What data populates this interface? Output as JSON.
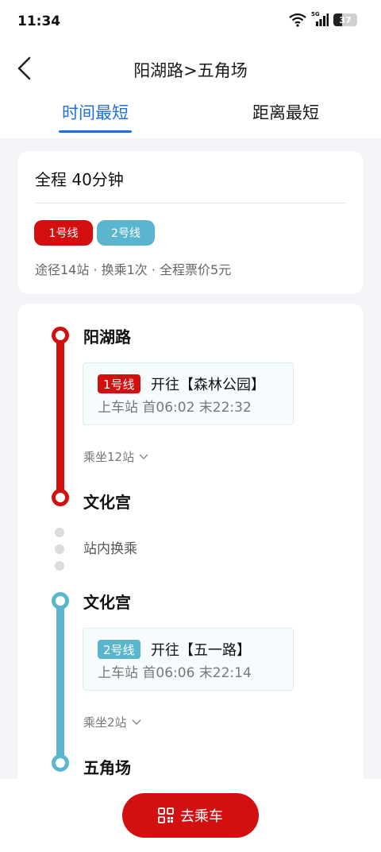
{
  "status": {
    "time": "11:34",
    "network": "5G",
    "battery": "37",
    "battery_level": 0.37
  },
  "nav": {
    "title": "阳湖路>五角场",
    "back_icon": "chevron-left-icon"
  },
  "tabs": [
    {
      "label": "时间最短",
      "active": true
    },
    {
      "label": "距离最短",
      "active": false
    }
  ],
  "summary": {
    "total": "全程 40分钟",
    "lines": [
      {
        "label": "1号线",
        "color": "#d40f0f"
      },
      {
        "label": "2号线",
        "color": "#5ab6cf"
      }
    ],
    "info": "途径14站 · 换乘1次 · 全程票价5元"
  },
  "route": {
    "segments": [
      {
        "line": "1号线",
        "color": "#d40f0f",
        "board_station": "阳湖路",
        "direction": "开往【森林公园】",
        "times": "上车站  首06:02  末22:32",
        "ride": "乘坐12站",
        "alight_station": "文化宫"
      },
      {
        "line": "2号线",
        "color": "#5ab6cf",
        "board_station": "文化宫",
        "direction": "开往【五一路】",
        "times": "上车站  首06:06  末22:14",
        "ride": "乘坐2站",
        "alight_station": "五角场"
      }
    ],
    "transfer_text": "站内换乘"
  },
  "footer": {
    "go_label": "去乘车",
    "go_icon": "qr-code-icon"
  }
}
